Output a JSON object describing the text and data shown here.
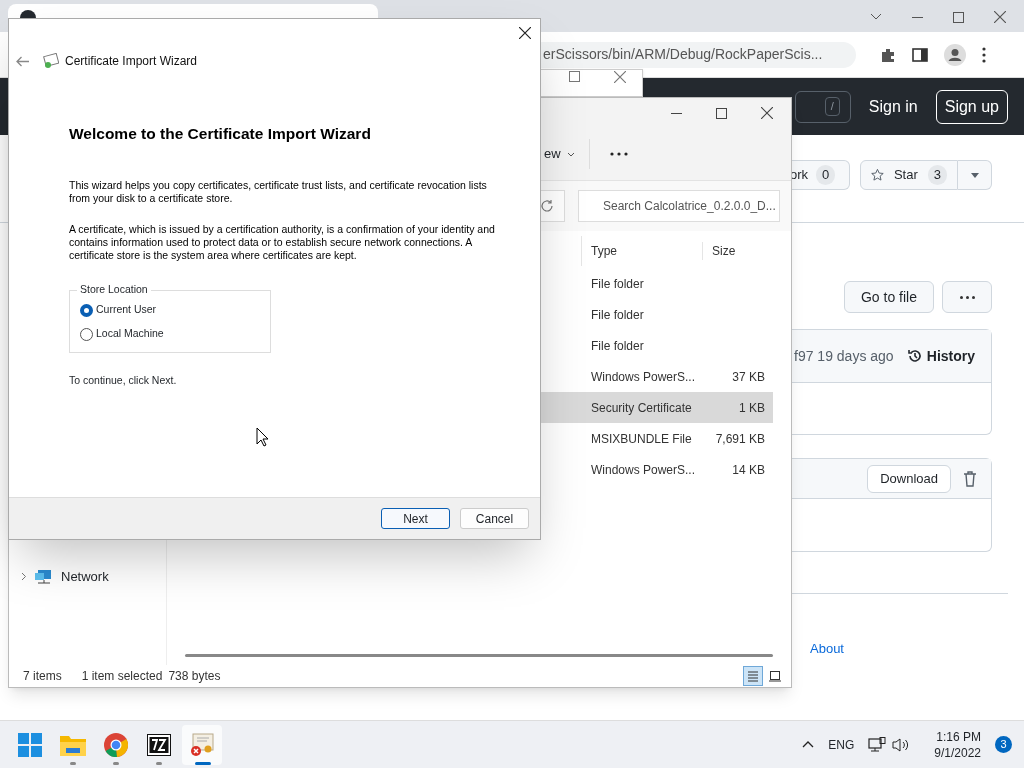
{
  "browser": {
    "url": "erScissors/bin/ARM/Debug/RockPaperScis...",
    "header": {
      "search_key": "/",
      "sign_in": "Sign in",
      "sign_up": "Sign up"
    },
    "repo_actions": [
      {
        "label": "ork",
        "count": "0"
      },
      {
        "label": "Star",
        "count": "3"
      }
    ],
    "go_to_file": "Go to file",
    "commit": "f97 19 days ago",
    "history": "History",
    "download": "Download",
    "about": "About"
  },
  "explorer": {
    "view_menu": "ew",
    "search_placeholder": "Search Calcolatrice_0.2.0.0_D...",
    "columns": [
      "Type",
      "Size"
    ],
    "rows": [
      {
        "type": "File folder",
        "size": "",
        "selected": false
      },
      {
        "type": "File folder",
        "size": "",
        "selected": false
      },
      {
        "type": "File folder",
        "size": "",
        "selected": false
      },
      {
        "type": "Windows PowerS...",
        "size": "37 KB",
        "selected": false
      },
      {
        "type": "Security Certificate",
        "size": "1 KB",
        "selected": true
      },
      {
        "type": "MSIXBUNDLE File",
        "size": "7,691 KB",
        "selected": false
      },
      {
        "type": "Windows PowerS...",
        "size": "14 KB",
        "selected": false
      }
    ],
    "nav": [
      {
        "label": "Network",
        "expanded": false
      }
    ],
    "status": [
      "7 items",
      "1 item selected",
      "738 bytes"
    ],
    "views": [
      {
        "kind": "details",
        "selected": true
      },
      {
        "kind": "tiles",
        "selected": false
      }
    ]
  },
  "dialog": {
    "title": "Certificate Import Wizard",
    "heading": "Welcome to the Certificate Import Wizard",
    "paragraphs": [
      "This wizard helps you copy certificates, certificate trust lists, and certificate revocation lists from your disk to a certificate store.",
      "A certificate, which is issued by a certification authority, is a confirmation of your identity and contains information used to protect data or to establish secure network connections. A certificate store is the system area where certificates are kept."
    ],
    "group_label": "Store Location",
    "options": [
      {
        "label": "Current User",
        "selected": true
      },
      {
        "label": "Local Machine",
        "selected": false
      }
    ],
    "footer_note": "To continue, click Next.",
    "buttons": [
      {
        "label": "Next",
        "kind": "default"
      },
      {
        "label": "Cancel",
        "kind": "normal"
      }
    ]
  },
  "taskbar": {
    "apps": [
      {
        "kind": "start",
        "running": false,
        "active": false
      },
      {
        "kind": "folder",
        "running": true,
        "active": false
      },
      {
        "kind": "chrome",
        "running": true,
        "active": false
      },
      {
        "kind": "sevenzip",
        "running": true,
        "active": false
      },
      {
        "kind": "certificate",
        "running": true,
        "active": true
      }
    ],
    "language": "ENG",
    "time": "1:16 PM",
    "date": "9/1/2022",
    "notifications": "3"
  }
}
